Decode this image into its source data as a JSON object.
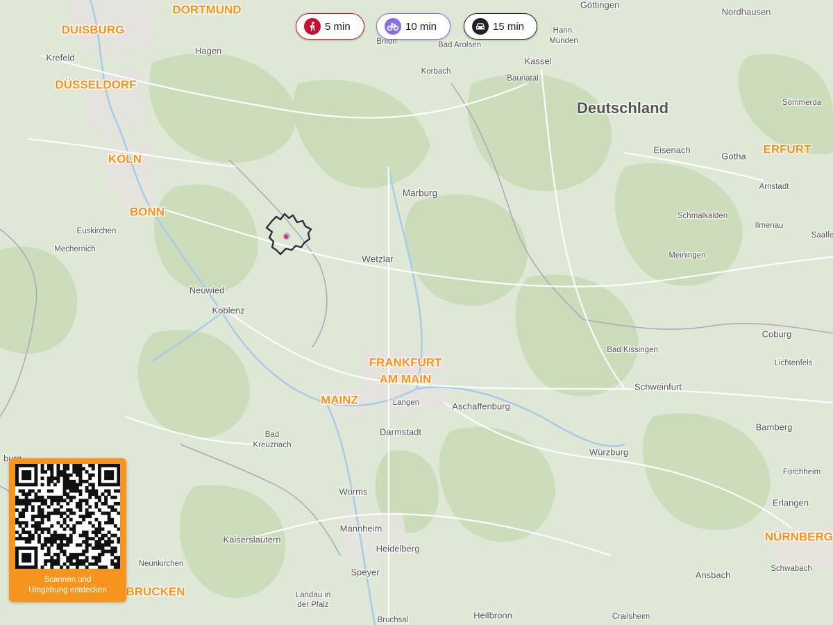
{
  "map": {
    "country_label": "Deutschland",
    "major_cities": [
      "DORTMUND",
      "DUISBURG",
      "DÜSSELDORF",
      "KÖLN",
      "BONN",
      "FRANKFURT",
      "AM MAIN",
      "MAINZ",
      "ERFURT",
      "NÜRNBERG",
      "BRÜCKEN"
    ],
    "towns": [
      "Göttingen",
      "Nordhausen",
      "Hann.",
      "Münden",
      "Bad Arolsen",
      "Kassel",
      "Baunatal",
      "Korbach",
      "Sömmerda",
      "Eisenach",
      "Gotha",
      "Arnstadt",
      "Schmalkalden",
      "Ilmenau",
      "Saalfe",
      "Meiningen",
      "Marburg",
      "Wetzlar",
      "Hagen",
      "Krefeld",
      "Euskirchen",
      "Mechernich",
      "Neuwied",
      "Koblenz",
      "Bad",
      "Kreuznach",
      "Langen",
      "Aschaffenburg",
      "Darmstadt",
      "Würzburg",
      "Schweinfurt",
      "Bad Kissingen",
      "Coburg",
      "Lichtenfels",
      "Bamberg",
      "Forchheim",
      "Erlangen",
      "Schwabach",
      "Ansbach",
      "Crailsheim",
      "Heilbronn",
      "Bruchsal",
      "Speyer",
      "Heidelberg",
      "Mannheim",
      "Worms",
      "Kaiserslautern",
      "Neunkirchen",
      "Landau in",
      "der Pfalz",
      "Brilon",
      "burg"
    ],
    "colors": {
      "land": "#dfe8d6",
      "forest": "#c7d9b5",
      "water": "#a9cbe8",
      "road": "#ffffff",
      "border": "#a79cb0",
      "city_label": "#f7941d",
      "town_label": "#555555",
      "isochrone": "#2b2f3a",
      "accent_walk": "#c8102e",
      "accent_bike": "#8a6ee0",
      "accent_car": "#222222"
    }
  },
  "travel_modes": [
    {
      "mode": "walk",
      "icon": "walking-person-icon",
      "label": "5 min"
    },
    {
      "mode": "bike",
      "icon": "bicycle-icon",
      "label": "10 min"
    },
    {
      "mode": "car",
      "icon": "car-icon",
      "label": "15 min"
    }
  ],
  "qr": {
    "caption_line1": "Scannen und",
    "caption_line2": "Umgebung entdecken",
    "background": "#f7941d"
  }
}
